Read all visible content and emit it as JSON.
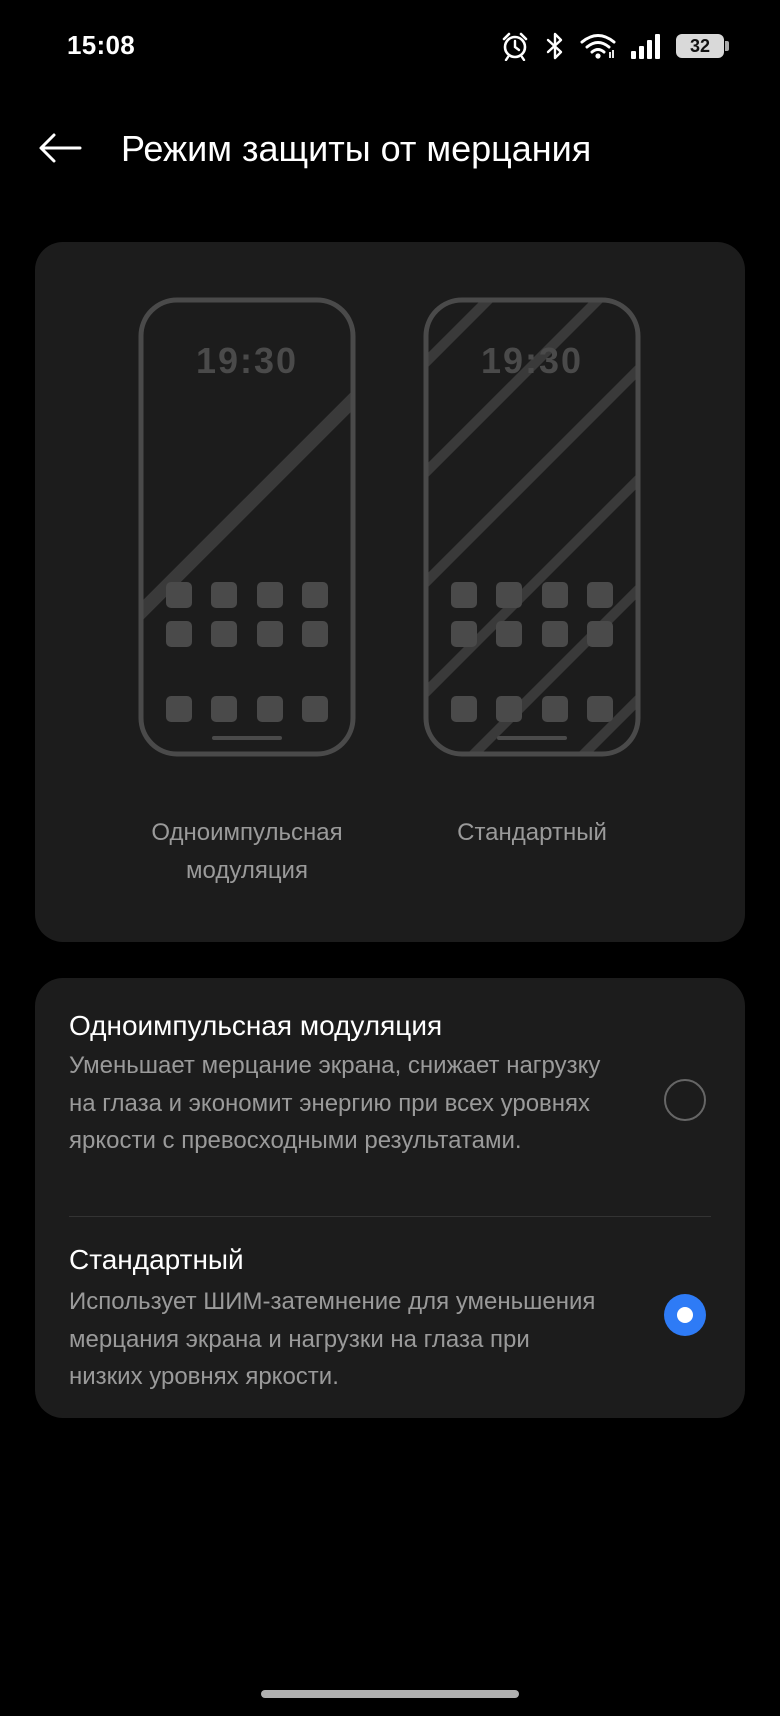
{
  "status_bar": {
    "time": "15:08",
    "battery": "32",
    "icons": [
      "alarm-icon",
      "bluetooth-icon",
      "wifi-icon",
      "signal-icon",
      "battery-icon"
    ]
  },
  "header": {
    "title": "Режим защиты от мерцания",
    "back_icon": "arrow-left-icon"
  },
  "preview": {
    "phone_clock": "19:30",
    "items": [
      {
        "label": "Одноимпульсная модуляция"
      },
      {
        "label": "Стандартный"
      }
    ]
  },
  "options": [
    {
      "title": "Одноимпульсная модуляция",
      "description": "Уменьшает мерцание экрана, снижает нагрузку на глаза и экономит энергию при всех уровнях яркости с превосходными результатами.",
      "selected": false
    },
    {
      "title": "Стандартный",
      "description": "Использует ШИМ-затемнение для уменьшения мерцания экрана и нагрузки на глаза при низких уровнях яркости.",
      "selected": true
    }
  ],
  "colors": {
    "background": "#000000",
    "card": "#1c1c1c",
    "accent": "#2e7bf6",
    "secondary_text": "#9a9a9a"
  }
}
